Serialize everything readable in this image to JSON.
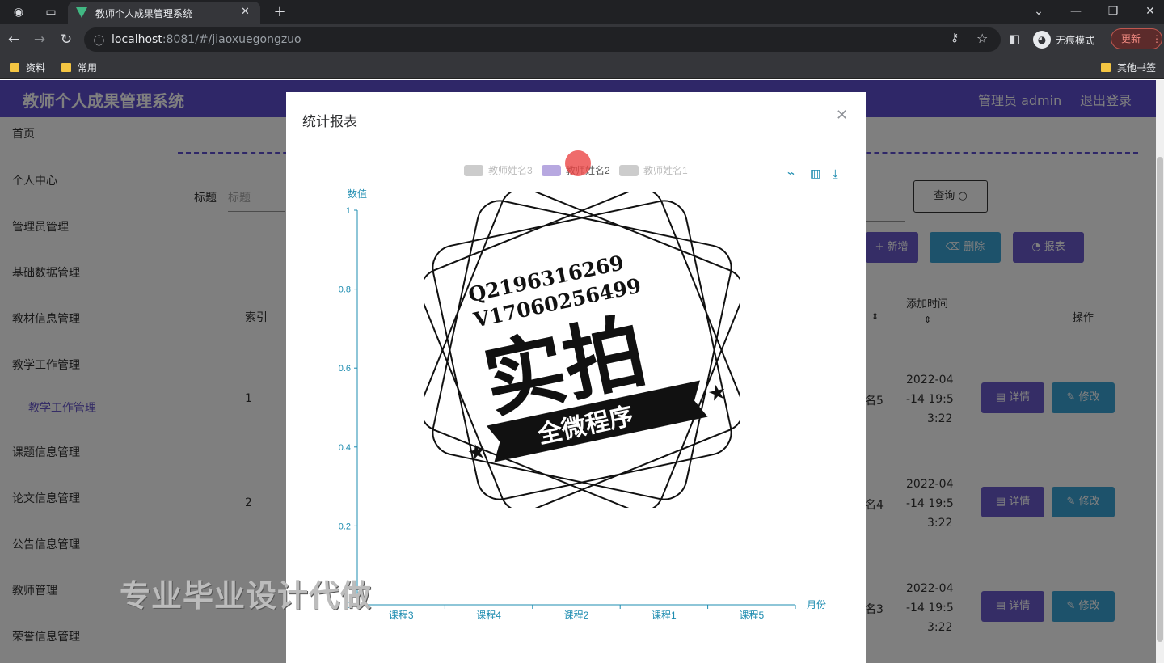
{
  "browser": {
    "tab_title": "教师个人成果管理系统",
    "url_host": "localhost",
    "url_rest": ":8081/#/jiaoxuegongzuo",
    "incognito_label": "无痕模式",
    "update_label": "更新",
    "bookmarks": [
      "资料",
      "常用"
    ],
    "other_bookmarks": "其他书签"
  },
  "app": {
    "title": "教师个人成果管理系统",
    "admin_label": "管理员 admin",
    "logout_label": "退出登录"
  },
  "sidebar": {
    "items": [
      "首页",
      "个人中心",
      "管理员管理",
      "基础数据管理",
      "教材信息管理",
      "教学工作管理",
      "教学工作管理",
      "课题信息管理",
      "论文信息管理",
      "公告信息管理",
      "教师管理",
      "荣誉信息管理"
    ]
  },
  "main": {
    "search_label": "标题",
    "search_placeholder": "标题",
    "query_button": "查询",
    "add_button": "新增",
    "delete_button": "删除",
    "report_button": "报表",
    "col_index": "索引",
    "col_add_time": "添加时间",
    "col_actions": "操作",
    "rows": [
      {
        "index": "1",
        "name_tail": "名5",
        "time_l1": "2022-04",
        "time_l2": "-14 19:5",
        "time_l3": "3:22"
      },
      {
        "index": "2",
        "name_tail": "名4",
        "time_l1": "2022-04",
        "time_l2": "-14 19:5",
        "time_l3": "3:22"
      },
      {
        "index": "3",
        "name_tail": "名3",
        "time_l1": "2022-04",
        "time_l2": "-14 19:5",
        "time_l3": "3:22"
      }
    ],
    "detail_button": "详情",
    "edit_button": "修改"
  },
  "dialog": {
    "title": "统计报表"
  },
  "chart_data": {
    "type": "bar",
    "categories": [
      "课程3",
      "课程4",
      "课程2",
      "课程1",
      "课程5"
    ],
    "series": [
      {
        "name": "教师姓名3",
        "values": [
          0,
          0,
          0,
          0,
          0
        ]
      },
      {
        "name": "教师姓名2",
        "values": [
          0,
          0,
          0,
          0,
          0
        ]
      },
      {
        "name": "教师姓名1",
        "values": [
          0,
          0,
          0,
          0,
          0
        ]
      }
    ],
    "legend_colors": [
      "#cccccc",
      "#b7a8e0",
      "#cccccc"
    ],
    "xlabel": "月份",
    "ylabel": "数值",
    "ylim": [
      0,
      1
    ],
    "yticks": [
      "0",
      "0.2",
      "0.4",
      "0.6",
      "0.8",
      "1"
    ],
    "axis_color": "#1d8cb0",
    "grid": false,
    "legend_position": "top-center"
  },
  "watermark": {
    "line1": "Q2196316269",
    "line2": "V17060256499",
    "big": "实拍",
    "banner": "全微程序",
    "overlay": "专业毕业设计代做"
  }
}
